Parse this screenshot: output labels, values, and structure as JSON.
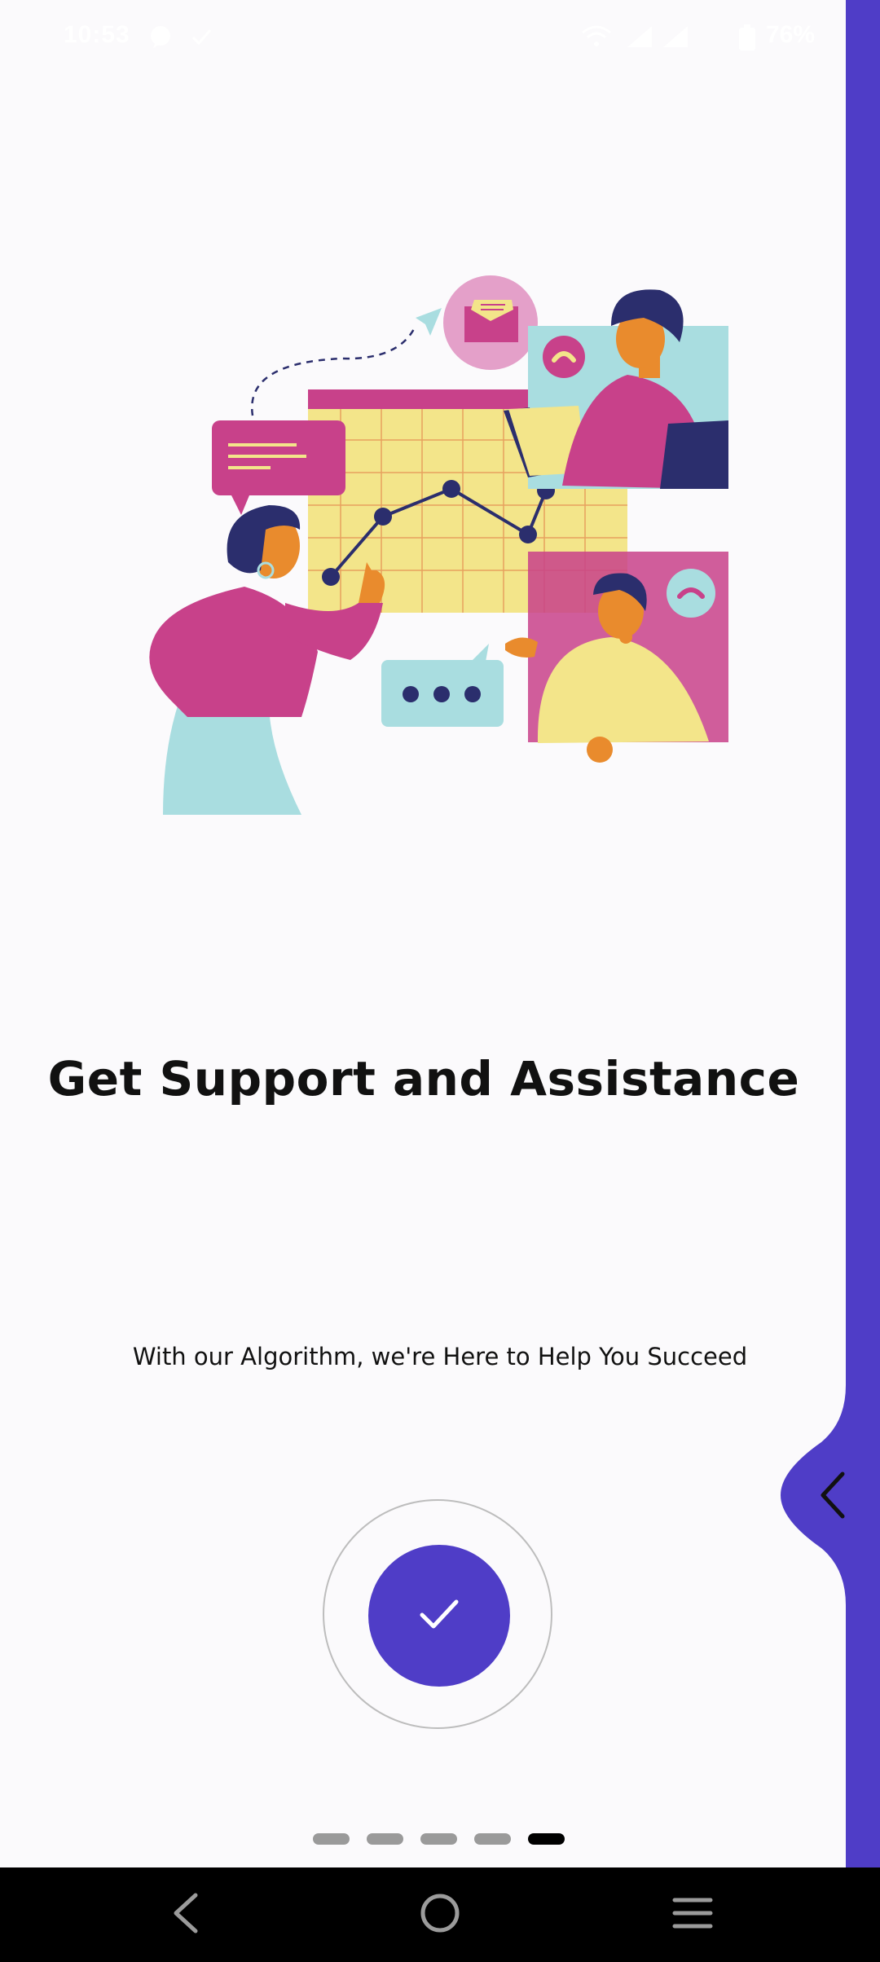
{
  "status_bar": {
    "time": "10:53",
    "battery": "76%",
    "icons": [
      "chat-bubble-icon",
      "check-icon",
      "wifi-icon",
      "signal-icon",
      "signal-icon",
      "battery-icon"
    ]
  },
  "onboarding": {
    "title": "Get Support and Assistance",
    "subtitle": "With our Algorithm, we're Here to Help You Succeed",
    "illustration": "team-support-illustration",
    "done_icon": "checkmark-icon",
    "back_tab_icon": "chevron-left-icon",
    "page_count": 5,
    "current_page": 5
  },
  "nav_bar": {
    "buttons": [
      "back-icon",
      "home-icon",
      "menu-icon"
    ]
  },
  "colors": {
    "accent": "#4f3dc7",
    "background": "#fbfafc",
    "magenta": "#c8418a",
    "yellow": "#f3e58a",
    "teal": "#a9dde0",
    "navy": "#2b2e6d",
    "orange": "#e98b2d"
  }
}
